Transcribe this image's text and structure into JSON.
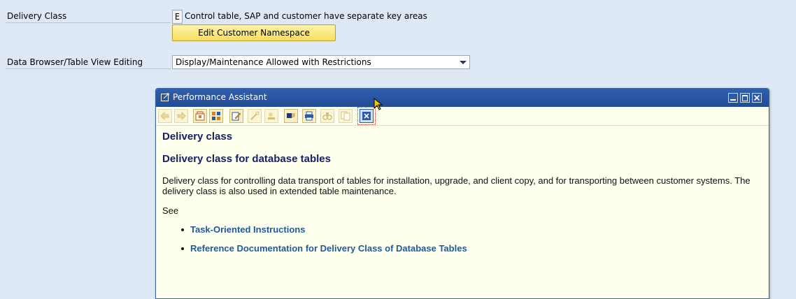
{
  "form": {
    "delivery_class_label": "Delivery Class",
    "delivery_class_key": "E",
    "delivery_class_text": "Control table, SAP and customer have separate key areas",
    "namespace_button": "Edit Customer Namespace",
    "browser_label": "Data Browser/Table View Editing",
    "browser_value": "Display/Maintenance Allowed with Restrictions"
  },
  "assistant": {
    "title": "Performance Assistant",
    "toolbar_icons": [
      "back-icon",
      "forward-icon",
      "technical-info-icon",
      "application-help-icon",
      "edit-icon",
      "settings-icon",
      "glossary-icon",
      "tree-icon",
      "print-icon",
      "find-icon",
      "copy-icon",
      "close-icon"
    ],
    "heading": "Delivery class",
    "subheading": "Delivery class for database tables",
    "paragraph_line1": "Delivery class for controlling data transport of tables for installation, upgrade, and client copy, and for transporting between customer systems. The",
    "paragraph_line2": "delivery class is also used in extended table maintenance.",
    "see_label": "See",
    "links": [
      "Task-Oriented Instructions",
      "Reference Documentation for Delivery Class of Database Tables"
    ]
  },
  "colors": {
    "background": "#dfe9f5",
    "title_bar": "#2f5fae",
    "help_background": "#ffffee",
    "heading": "#16216a",
    "link": "#1d5aa0",
    "button": "#f9de5e"
  }
}
